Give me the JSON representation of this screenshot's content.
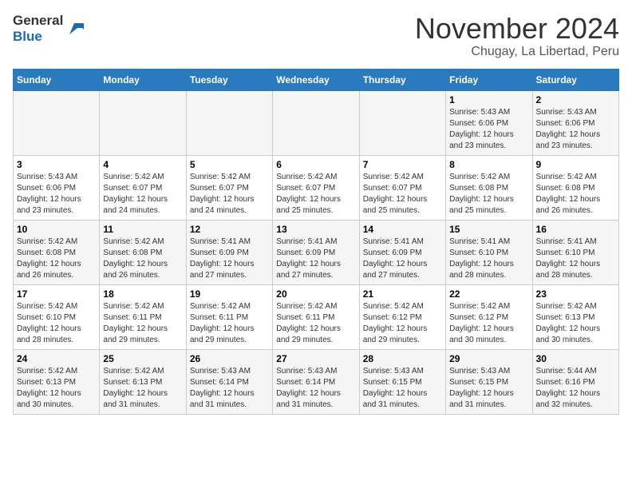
{
  "logo": {
    "line1": "General",
    "line2": "Blue"
  },
  "title": "November 2024",
  "subtitle": "Chugay, La Libertad, Peru",
  "weekdays": [
    "Sunday",
    "Monday",
    "Tuesday",
    "Wednesday",
    "Thursday",
    "Friday",
    "Saturday"
  ],
  "weeks": [
    [
      {
        "day": "",
        "info": ""
      },
      {
        "day": "",
        "info": ""
      },
      {
        "day": "",
        "info": ""
      },
      {
        "day": "",
        "info": ""
      },
      {
        "day": "",
        "info": ""
      },
      {
        "day": "1",
        "info": "Sunrise: 5:43 AM\nSunset: 6:06 PM\nDaylight: 12 hours\nand 23 minutes."
      },
      {
        "day": "2",
        "info": "Sunrise: 5:43 AM\nSunset: 6:06 PM\nDaylight: 12 hours\nand 23 minutes."
      }
    ],
    [
      {
        "day": "3",
        "info": "Sunrise: 5:43 AM\nSunset: 6:06 PM\nDaylight: 12 hours\nand 23 minutes."
      },
      {
        "day": "4",
        "info": "Sunrise: 5:42 AM\nSunset: 6:07 PM\nDaylight: 12 hours\nand 24 minutes."
      },
      {
        "day": "5",
        "info": "Sunrise: 5:42 AM\nSunset: 6:07 PM\nDaylight: 12 hours\nand 24 minutes."
      },
      {
        "day": "6",
        "info": "Sunrise: 5:42 AM\nSunset: 6:07 PM\nDaylight: 12 hours\nand 25 minutes."
      },
      {
        "day": "7",
        "info": "Sunrise: 5:42 AM\nSunset: 6:07 PM\nDaylight: 12 hours\nand 25 minutes."
      },
      {
        "day": "8",
        "info": "Sunrise: 5:42 AM\nSunset: 6:08 PM\nDaylight: 12 hours\nand 25 minutes."
      },
      {
        "day": "9",
        "info": "Sunrise: 5:42 AM\nSunset: 6:08 PM\nDaylight: 12 hours\nand 26 minutes."
      }
    ],
    [
      {
        "day": "10",
        "info": "Sunrise: 5:42 AM\nSunset: 6:08 PM\nDaylight: 12 hours\nand 26 minutes."
      },
      {
        "day": "11",
        "info": "Sunrise: 5:42 AM\nSunset: 6:08 PM\nDaylight: 12 hours\nand 26 minutes."
      },
      {
        "day": "12",
        "info": "Sunrise: 5:41 AM\nSunset: 6:09 PM\nDaylight: 12 hours\nand 27 minutes."
      },
      {
        "day": "13",
        "info": "Sunrise: 5:41 AM\nSunset: 6:09 PM\nDaylight: 12 hours\nand 27 minutes."
      },
      {
        "day": "14",
        "info": "Sunrise: 5:41 AM\nSunset: 6:09 PM\nDaylight: 12 hours\nand 27 minutes."
      },
      {
        "day": "15",
        "info": "Sunrise: 5:41 AM\nSunset: 6:10 PM\nDaylight: 12 hours\nand 28 minutes."
      },
      {
        "day": "16",
        "info": "Sunrise: 5:41 AM\nSunset: 6:10 PM\nDaylight: 12 hours\nand 28 minutes."
      }
    ],
    [
      {
        "day": "17",
        "info": "Sunrise: 5:42 AM\nSunset: 6:10 PM\nDaylight: 12 hours\nand 28 minutes."
      },
      {
        "day": "18",
        "info": "Sunrise: 5:42 AM\nSunset: 6:11 PM\nDaylight: 12 hours\nand 29 minutes."
      },
      {
        "day": "19",
        "info": "Sunrise: 5:42 AM\nSunset: 6:11 PM\nDaylight: 12 hours\nand 29 minutes."
      },
      {
        "day": "20",
        "info": "Sunrise: 5:42 AM\nSunset: 6:11 PM\nDaylight: 12 hours\nand 29 minutes."
      },
      {
        "day": "21",
        "info": "Sunrise: 5:42 AM\nSunset: 6:12 PM\nDaylight: 12 hours\nand 29 minutes."
      },
      {
        "day": "22",
        "info": "Sunrise: 5:42 AM\nSunset: 6:12 PM\nDaylight: 12 hours\nand 30 minutes."
      },
      {
        "day": "23",
        "info": "Sunrise: 5:42 AM\nSunset: 6:13 PM\nDaylight: 12 hours\nand 30 minutes."
      }
    ],
    [
      {
        "day": "24",
        "info": "Sunrise: 5:42 AM\nSunset: 6:13 PM\nDaylight: 12 hours\nand 30 minutes."
      },
      {
        "day": "25",
        "info": "Sunrise: 5:42 AM\nSunset: 6:13 PM\nDaylight: 12 hours\nand 31 minutes."
      },
      {
        "day": "26",
        "info": "Sunrise: 5:43 AM\nSunset: 6:14 PM\nDaylight: 12 hours\nand 31 minutes."
      },
      {
        "day": "27",
        "info": "Sunrise: 5:43 AM\nSunset: 6:14 PM\nDaylight: 12 hours\nand 31 minutes."
      },
      {
        "day": "28",
        "info": "Sunrise: 5:43 AM\nSunset: 6:15 PM\nDaylight: 12 hours\nand 31 minutes."
      },
      {
        "day": "29",
        "info": "Sunrise: 5:43 AM\nSunset: 6:15 PM\nDaylight: 12 hours\nand 31 minutes."
      },
      {
        "day": "30",
        "info": "Sunrise: 5:44 AM\nSunset: 6:16 PM\nDaylight: 12 hours\nand 32 minutes."
      }
    ]
  ]
}
